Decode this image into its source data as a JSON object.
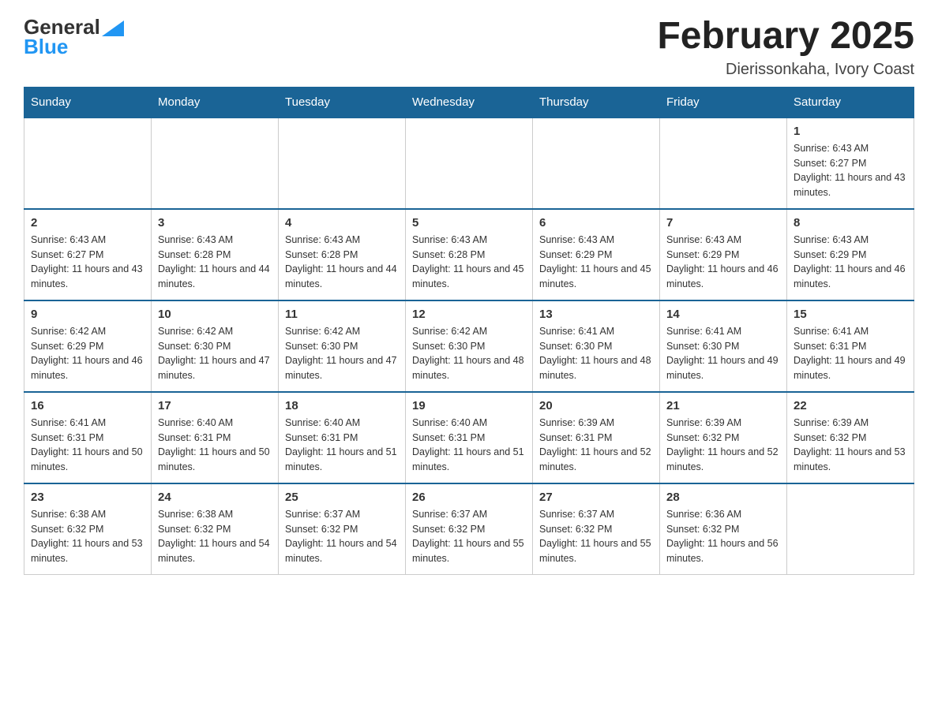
{
  "header": {
    "logo_text_general": "General",
    "logo_text_blue": "Blue",
    "month_title": "February 2025",
    "location": "Dierissonkaha, Ivory Coast"
  },
  "days_of_week": [
    "Sunday",
    "Monday",
    "Tuesday",
    "Wednesday",
    "Thursday",
    "Friday",
    "Saturday"
  ],
  "weeks": [
    [
      {
        "day": "",
        "info": ""
      },
      {
        "day": "",
        "info": ""
      },
      {
        "day": "",
        "info": ""
      },
      {
        "day": "",
        "info": ""
      },
      {
        "day": "",
        "info": ""
      },
      {
        "day": "",
        "info": ""
      },
      {
        "day": "1",
        "info": "Sunrise: 6:43 AM\nSunset: 6:27 PM\nDaylight: 11 hours and 43 minutes."
      }
    ],
    [
      {
        "day": "2",
        "info": "Sunrise: 6:43 AM\nSunset: 6:27 PM\nDaylight: 11 hours and 43 minutes."
      },
      {
        "day": "3",
        "info": "Sunrise: 6:43 AM\nSunset: 6:28 PM\nDaylight: 11 hours and 44 minutes."
      },
      {
        "day": "4",
        "info": "Sunrise: 6:43 AM\nSunset: 6:28 PM\nDaylight: 11 hours and 44 minutes."
      },
      {
        "day": "5",
        "info": "Sunrise: 6:43 AM\nSunset: 6:28 PM\nDaylight: 11 hours and 45 minutes."
      },
      {
        "day": "6",
        "info": "Sunrise: 6:43 AM\nSunset: 6:29 PM\nDaylight: 11 hours and 45 minutes."
      },
      {
        "day": "7",
        "info": "Sunrise: 6:43 AM\nSunset: 6:29 PM\nDaylight: 11 hours and 46 minutes."
      },
      {
        "day": "8",
        "info": "Sunrise: 6:43 AM\nSunset: 6:29 PM\nDaylight: 11 hours and 46 minutes."
      }
    ],
    [
      {
        "day": "9",
        "info": "Sunrise: 6:42 AM\nSunset: 6:29 PM\nDaylight: 11 hours and 46 minutes."
      },
      {
        "day": "10",
        "info": "Sunrise: 6:42 AM\nSunset: 6:30 PM\nDaylight: 11 hours and 47 minutes."
      },
      {
        "day": "11",
        "info": "Sunrise: 6:42 AM\nSunset: 6:30 PM\nDaylight: 11 hours and 47 minutes."
      },
      {
        "day": "12",
        "info": "Sunrise: 6:42 AM\nSunset: 6:30 PM\nDaylight: 11 hours and 48 minutes."
      },
      {
        "day": "13",
        "info": "Sunrise: 6:41 AM\nSunset: 6:30 PM\nDaylight: 11 hours and 48 minutes."
      },
      {
        "day": "14",
        "info": "Sunrise: 6:41 AM\nSunset: 6:30 PM\nDaylight: 11 hours and 49 minutes."
      },
      {
        "day": "15",
        "info": "Sunrise: 6:41 AM\nSunset: 6:31 PM\nDaylight: 11 hours and 49 minutes."
      }
    ],
    [
      {
        "day": "16",
        "info": "Sunrise: 6:41 AM\nSunset: 6:31 PM\nDaylight: 11 hours and 50 minutes."
      },
      {
        "day": "17",
        "info": "Sunrise: 6:40 AM\nSunset: 6:31 PM\nDaylight: 11 hours and 50 minutes."
      },
      {
        "day": "18",
        "info": "Sunrise: 6:40 AM\nSunset: 6:31 PM\nDaylight: 11 hours and 51 minutes."
      },
      {
        "day": "19",
        "info": "Sunrise: 6:40 AM\nSunset: 6:31 PM\nDaylight: 11 hours and 51 minutes."
      },
      {
        "day": "20",
        "info": "Sunrise: 6:39 AM\nSunset: 6:31 PM\nDaylight: 11 hours and 52 minutes."
      },
      {
        "day": "21",
        "info": "Sunrise: 6:39 AM\nSunset: 6:32 PM\nDaylight: 11 hours and 52 minutes."
      },
      {
        "day": "22",
        "info": "Sunrise: 6:39 AM\nSunset: 6:32 PM\nDaylight: 11 hours and 53 minutes."
      }
    ],
    [
      {
        "day": "23",
        "info": "Sunrise: 6:38 AM\nSunset: 6:32 PM\nDaylight: 11 hours and 53 minutes."
      },
      {
        "day": "24",
        "info": "Sunrise: 6:38 AM\nSunset: 6:32 PM\nDaylight: 11 hours and 54 minutes."
      },
      {
        "day": "25",
        "info": "Sunrise: 6:37 AM\nSunset: 6:32 PM\nDaylight: 11 hours and 54 minutes."
      },
      {
        "day": "26",
        "info": "Sunrise: 6:37 AM\nSunset: 6:32 PM\nDaylight: 11 hours and 55 minutes."
      },
      {
        "day": "27",
        "info": "Sunrise: 6:37 AM\nSunset: 6:32 PM\nDaylight: 11 hours and 55 minutes."
      },
      {
        "day": "28",
        "info": "Sunrise: 6:36 AM\nSunset: 6:32 PM\nDaylight: 11 hours and 56 minutes."
      },
      {
        "day": "",
        "info": ""
      }
    ]
  ]
}
